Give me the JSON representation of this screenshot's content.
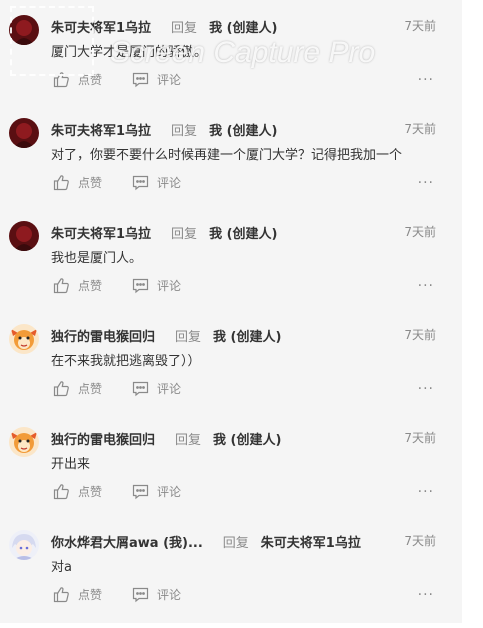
{
  "labels": {
    "reply": "回复",
    "like": "点赞",
    "comment": "评论",
    "more": "···"
  },
  "watermark": "Screen Capture Pro",
  "comments": [
    {
      "author": "朱可夫将军1乌拉",
      "target": "我 (创建人)",
      "time": "7天前",
      "content": "厦门大学才是厦门的骄傲。",
      "avatar": "dark-red-avatar"
    },
    {
      "author": "朱可夫将军1乌拉",
      "target": "我 (创建人)",
      "time": "7天前",
      "content": "对了，你要不要什么时候再建一个厦门大学？记得把我加一个",
      "avatar": "dark-red-avatar"
    },
    {
      "author": "朱可夫将军1乌拉",
      "target": "我 (创建人)",
      "time": "7天前",
      "content": "我也是厦门人。",
      "avatar": "dark-red-avatar"
    },
    {
      "author": "独行的雷电猴回归",
      "target": "我 (创建人)",
      "time": "7天前",
      "content": "在不来我就把逃离毁了））",
      "avatar": "monkey-avatar"
    },
    {
      "author": "独行的雷电猴回归",
      "target": "我 (创建人)",
      "time": "7天前",
      "content": "开出来",
      "avatar": "monkey-avatar"
    },
    {
      "author": "你水烨君大屑awa (我)...",
      "target": "朱可夫将军1乌拉",
      "time": "7天前",
      "content": "对a",
      "avatar": "anime-avatar"
    }
  ]
}
